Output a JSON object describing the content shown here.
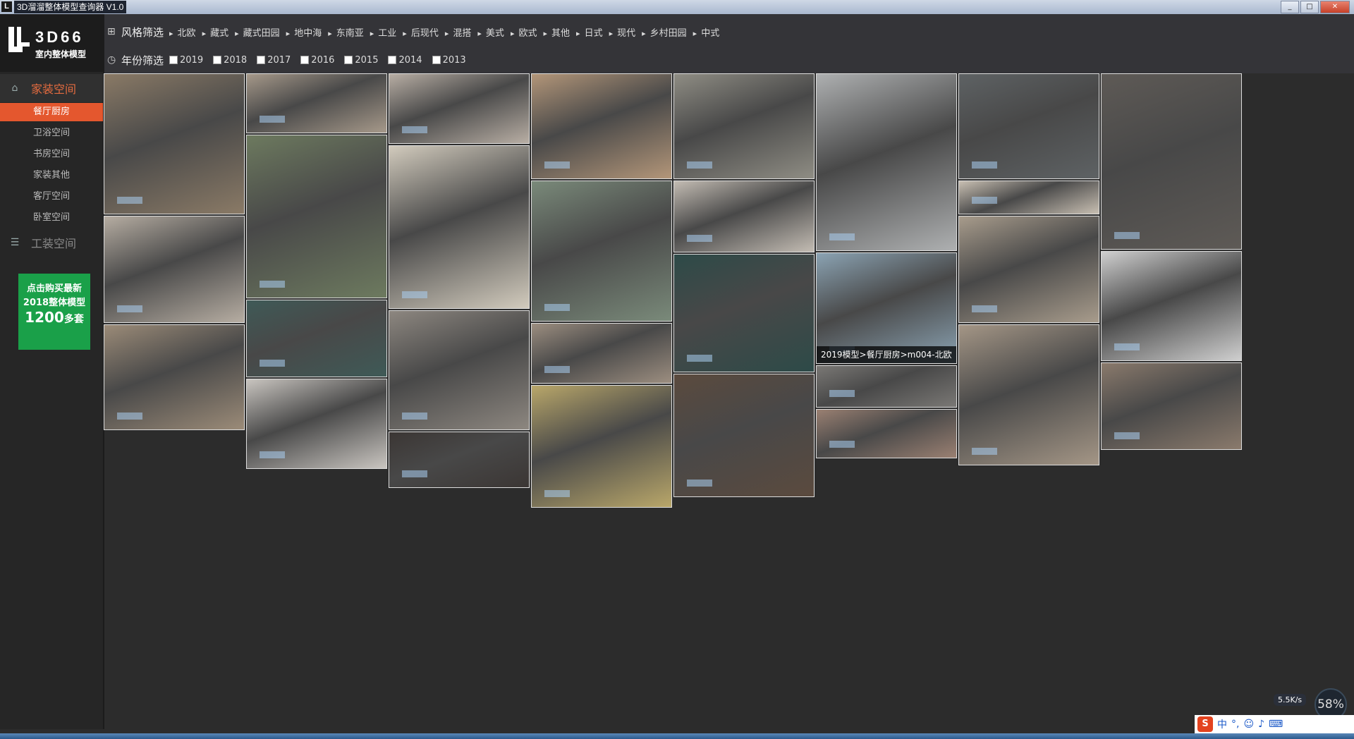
{
  "window": {
    "title": "3D溜溜整体模型查询器 V1.0",
    "icon_letter": "L",
    "controls": [
      "minimize-icon",
      "maximize-icon",
      "close-icon"
    ]
  },
  "logo": {
    "brand": "3D66",
    "sub": "室内整体模型"
  },
  "sidebar": {
    "home_category": "家装空间",
    "home_items": [
      "餐厅厨房",
      "卫浴空间",
      "书房空间",
      "家装其他",
      "客厅空间",
      "卧室空间"
    ],
    "active_item": "餐厅厨房",
    "work_category": "工装空间"
  },
  "promo": {
    "line1": "点击购买最新",
    "line2": "2018整体模型",
    "count": "1200",
    "suffix": "多套"
  },
  "filters": {
    "style_title": "风格筛选",
    "styles": [
      "北欧",
      "藏式",
      "藏式田园",
      "地中海",
      "东南亚",
      "工业",
      "后现代",
      "混搭",
      "美式",
      "欧式",
      "其他",
      "日式",
      "现代",
      "乡村田园",
      "中式"
    ],
    "year_title": "年份筛选",
    "years": [
      "2019",
      "2018",
      "2017",
      "2016",
      "2015",
      "2014",
      "2013"
    ]
  },
  "gallery": {
    "hover_caption": "2019模型>餐厅厨房>m004-北欧",
    "tiles": [
      {
        "col": 0,
        "row": 0,
        "color": "#8a7a66"
      },
      {
        "col": 0,
        "row": 1,
        "color": "#b6ada2"
      },
      {
        "col": 0,
        "row": 2,
        "color": "#9b8b78"
      },
      {
        "col": 1,
        "row": 0,
        "color": "#a6998a"
      },
      {
        "col": 1,
        "row": 1,
        "color": "#6d7a5f"
      },
      {
        "col": 1,
        "row": 2,
        "color": "#3f5a57"
      },
      {
        "col": 1,
        "row": 3,
        "color": "#c9c5c0"
      },
      {
        "col": 2,
        "row": 0,
        "color": "#b8aea4"
      },
      {
        "col": 2,
        "row": 1,
        "color": "#d2cbbd"
      },
      {
        "col": 2,
        "row": 2,
        "color": "#8d8780"
      },
      {
        "col": 2,
        "row": 3,
        "color": "#3b3634"
      },
      {
        "col": 3,
        "row": 0,
        "color": "#b39679"
      },
      {
        "col": 3,
        "row": 1,
        "color": "#7a8a7a"
      },
      {
        "col": 3,
        "row": 2,
        "color": "#9c8e80"
      },
      {
        "col": 3,
        "row": 3,
        "color": "#b9a76a"
      },
      {
        "col": 4,
        "row": 0,
        "color": "#8f8d84"
      },
      {
        "col": 4,
        "row": 1,
        "color": "#c3bcb3"
      },
      {
        "col": 4,
        "row": 2,
        "color": "#2d4a48"
      },
      {
        "col": 4,
        "row": 3,
        "color": "#5b4a3e"
      },
      {
        "col": 5,
        "row": 0,
        "color": "#aeb0b1"
      },
      {
        "col": 5,
        "row": 1,
        "color": "#8ba3b3"
      },
      {
        "col": 5,
        "row": 2,
        "color": "#7a7875"
      },
      {
        "col": 5,
        "row": 3,
        "color": "#9a8072"
      },
      {
        "col": 6,
        "row": 0,
        "color": "#5e6264"
      },
      {
        "col": 6,
        "row": 1,
        "color": "#c8bfb2"
      },
      {
        "col": 6,
        "row": 2,
        "color": "#a89c8c"
      },
      {
        "col": 6,
        "row": 3,
        "color": "#a49686"
      },
      {
        "col": 7,
        "row": 0,
        "color": "#5e5a56"
      },
      {
        "col": 7,
        "row": 1,
        "color": "#cfcfcf"
      },
      {
        "col": 7,
        "row": 2,
        "color": "#8a7a6c"
      }
    ]
  },
  "systray": {
    "net_rate": "5.5K/s",
    "cpu_percent": "58%",
    "ime_logo": "S",
    "ime_mode": "中"
  }
}
